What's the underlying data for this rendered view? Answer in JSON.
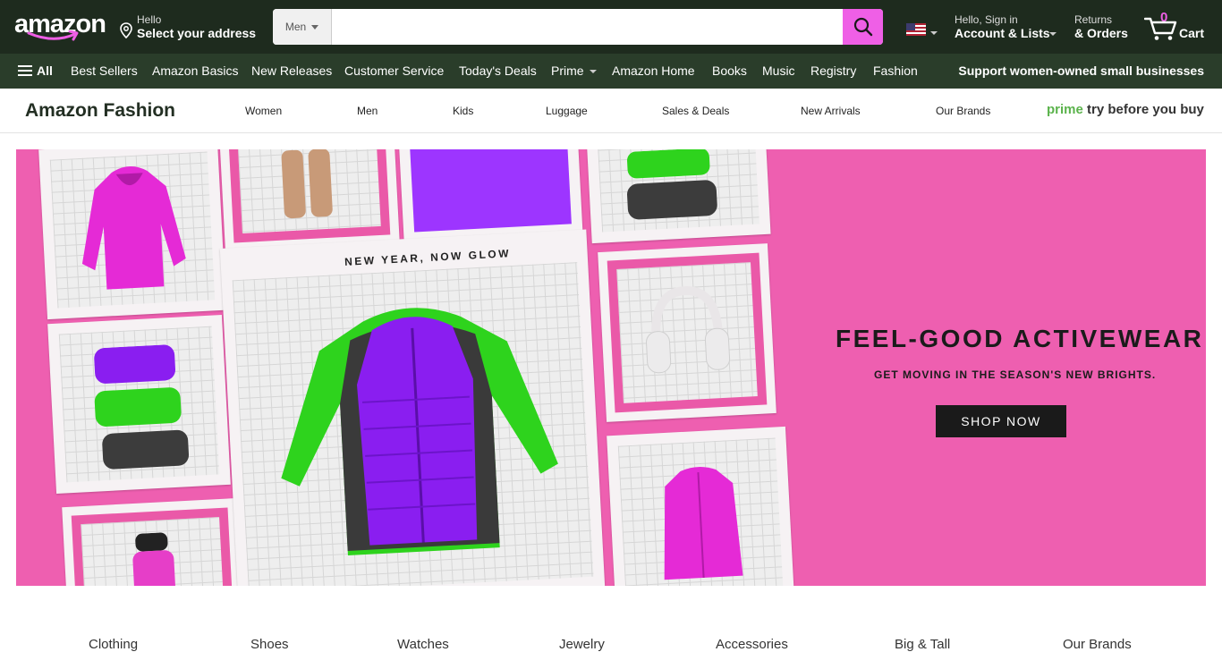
{
  "header": {
    "logo_text": "amazon",
    "address_line1": "Hello",
    "address_line2": "Select your address",
    "search": {
      "department": "Men",
      "placeholder": "",
      "value": ""
    },
    "account_line1": "Hello, Sign in",
    "account_line2": "Account & Lists",
    "returns_line1": "Returns",
    "returns_line2": "& Orders",
    "cart_count": "0",
    "cart_label": "Cart",
    "accent_color": "#ef5fe6"
  },
  "subnav": {
    "all_label": "All",
    "items": [
      "Best Sellers",
      "Amazon Basics",
      "New Releases",
      "Customer Service",
      "Today's Deals",
      "Prime",
      "Amazon Home",
      "Books",
      "Music",
      "Registry",
      "Fashion"
    ],
    "promo": "Support women-owned small businesses"
  },
  "fashion": {
    "brand": "Amazon Fashion",
    "items": [
      "Women",
      "Men",
      "Kids",
      "Luggage",
      "Sales & Deals",
      "New Arrivals",
      "Our Brands"
    ],
    "prime_word": "prime",
    "prime_tagline": "try before you buy"
  },
  "hero": {
    "caption": "NEW YEAR, NOW GLOW",
    "headline": "FEEL-GOOD ACTIVEWEAR",
    "subheadline": "GET MOVING IN THE SEASON'S NEW BRIGHTS.",
    "cta": "SHOP NOW",
    "background_color": "#ee5fb0"
  },
  "categories": [
    "Clothing",
    "Shoes",
    "Watches",
    "Jewelry",
    "Accessories",
    "Big & Tall",
    "Our Brands"
  ]
}
